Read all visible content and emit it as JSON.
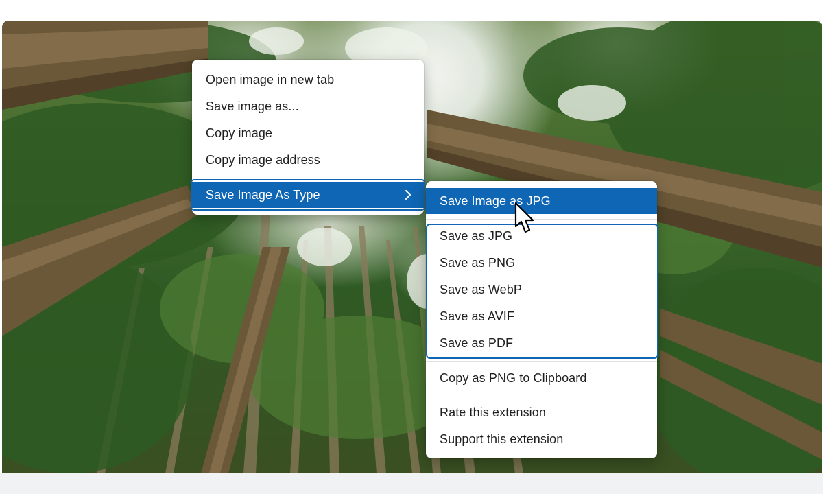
{
  "context_menu": {
    "items": [
      {
        "label": "Open image in new tab"
      },
      {
        "label": "Save image as..."
      },
      {
        "label": "Copy image"
      },
      {
        "label": "Copy image address"
      }
    ],
    "submenu_trigger": {
      "label": "Save Image As Type",
      "icon": "chevron-right-icon"
    }
  },
  "submenu": {
    "top_item": {
      "label": "Save Image as JPG"
    },
    "formats": [
      {
        "label": "Save as JPG"
      },
      {
        "label": "Save as PNG"
      },
      {
        "label": "Save as WebP"
      },
      {
        "label": "Save as AVIF"
      },
      {
        "label": "Save as PDF"
      }
    ],
    "clipboard_item": {
      "label": "Copy as PNG to Clipboard"
    },
    "extension_items": [
      {
        "label": "Rate this extension"
      },
      {
        "label": "Support this extension"
      }
    ]
  },
  "colors": {
    "highlight": "#0f66b4",
    "menu_background": "#ffffff",
    "text": "#1f1f1f"
  }
}
